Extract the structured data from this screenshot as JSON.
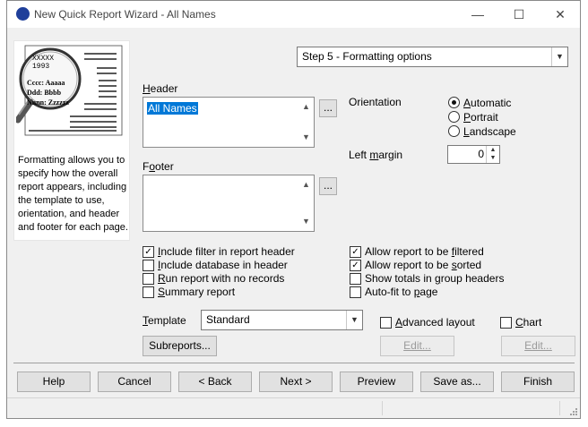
{
  "window": {
    "title": "New Quick Report Wizard - All Names"
  },
  "illustration": {
    "lines": [
      "XXXXX",
      "1993",
      "Cccc: Aaaaa",
      "Ddd: Bbbb",
      "Nnnn: Zzzzzz"
    ]
  },
  "description": "Formatting allows you to specify how the overall report appears, including the template to use, orientation, and header and footer for each page.",
  "step": {
    "selected": "Step 5 - Formatting options"
  },
  "header": {
    "label_pre": "",
    "label_u": "H",
    "label_post": "eader",
    "value": "All Names",
    "browse": "..."
  },
  "footer": {
    "label_pre": "F",
    "label_u": "o",
    "label_post": "oter",
    "value": "",
    "browse": "..."
  },
  "orientation": {
    "label": "Orientation",
    "options": [
      {
        "pre": "",
        "u": "A",
        "post": "utomatic",
        "checked": true
      },
      {
        "pre": "",
        "u": "P",
        "post": "ortrait",
        "checked": false
      },
      {
        "pre": "",
        "u": "L",
        "post": "andscape",
        "checked": false
      }
    ]
  },
  "left_margin": {
    "pre": "Left ",
    "u": "m",
    "post": "argin",
    "value": "0"
  },
  "checkboxes_left": [
    {
      "pre": "",
      "u": "I",
      "post": "nclude filter in report header",
      "checked": true
    },
    {
      "pre": "",
      "u": "I",
      "post": "nclude database in header",
      "checked": false
    },
    {
      "pre": "",
      "u": "R",
      "post": "un report with no records",
      "checked": false
    },
    {
      "pre": "",
      "u": "S",
      "post": "ummary report",
      "checked": false
    }
  ],
  "checkboxes_right": [
    {
      "pre": "Allow report to be ",
      "u": "f",
      "post": "iltered",
      "checked": true
    },
    {
      "pre": "Allow report to be ",
      "u": "s",
      "post": "orted",
      "checked": true
    },
    {
      "pre": "Show totals in ",
      "u": "g",
      "post": "roup headers",
      "checked": false
    },
    {
      "pre": "Auto-fit to ",
      "u": "p",
      "post": "age",
      "checked": false
    }
  ],
  "template": {
    "pre": "",
    "u": "T",
    "post": "emplate",
    "value": "Standard"
  },
  "advanced_layout": {
    "pre": "",
    "u": "A",
    "post": "dvanced layout",
    "checked": false
  },
  "chart": {
    "pre": "",
    "u": "C",
    "post": "hart",
    "checked": false
  },
  "buttons": {
    "subreports": "Subreports...",
    "edit1": "Edit...",
    "edit2": "Edit...",
    "help": "Help",
    "cancel": "Cancel",
    "back": "< Back",
    "next": "Next >",
    "preview": "Preview",
    "save_as": "Save as...",
    "finish": "Finish"
  }
}
